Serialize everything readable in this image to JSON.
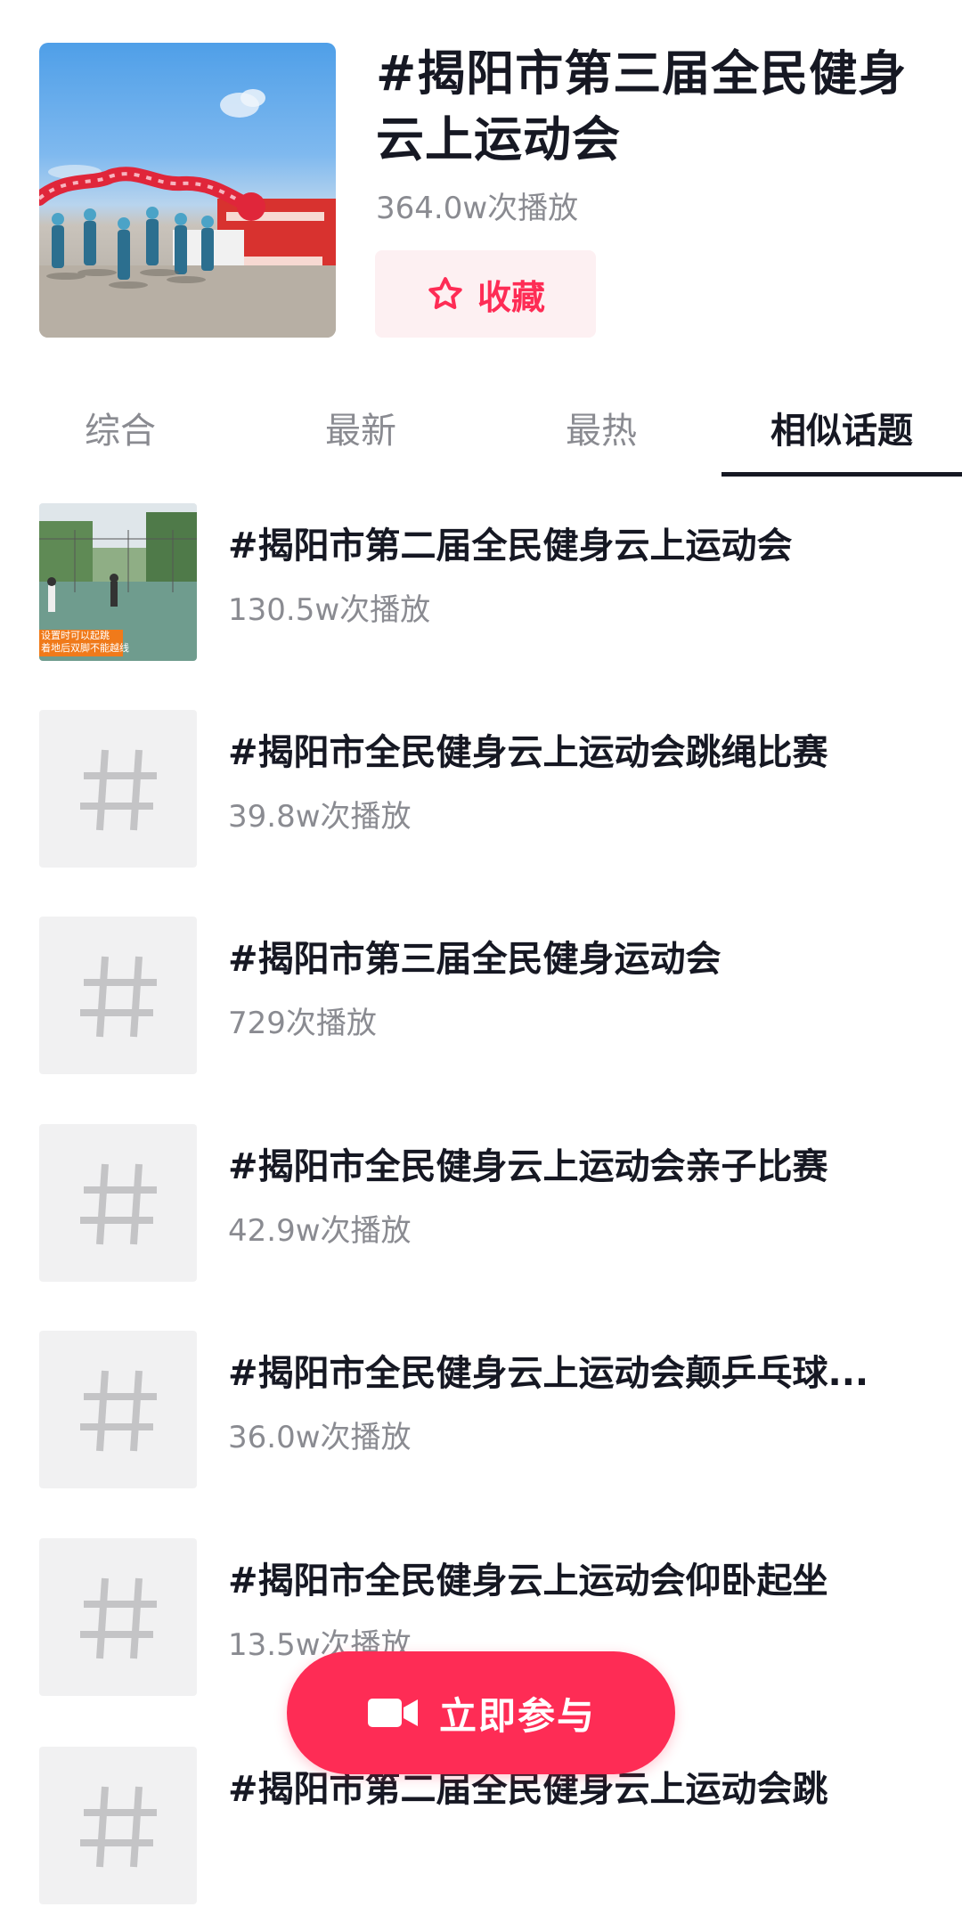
{
  "header": {
    "title": "#揭阳市第三届全民健身云上运动会",
    "plays": "364.0w次播放",
    "favorite_label": "收藏",
    "favorite_icon": "star-outline-icon",
    "accent_color": "#fe2c55"
  },
  "tabs": [
    {
      "label": "综合",
      "active": false
    },
    {
      "label": "最新",
      "active": false
    },
    {
      "label": "最热",
      "active": false
    },
    {
      "label": "相似话题",
      "active": true
    }
  ],
  "topics": [
    {
      "title": "#揭阳市第二届全民健身云上运动会",
      "plays": "130.5w次播放",
      "thumb": "photo",
      "thumb_caption_1": "设置时可以起跳",
      "thumb_caption_2": "着地后双脚不能越线"
    },
    {
      "title": "#揭阳市全民健身云上运动会跳绳比赛",
      "plays": "39.8w次播放",
      "thumb": "hashtag-icon"
    },
    {
      "title": "#揭阳市第三届全民健身运动会",
      "plays": "729次播放",
      "thumb": "hashtag-icon"
    },
    {
      "title": "#揭阳市全民健身云上运动会亲子比赛",
      "plays": "42.9w次播放",
      "thumb": "hashtag-icon"
    },
    {
      "title": "#揭阳市全民健身云上运动会颠乒乓球...",
      "plays": "36.0w次播放",
      "thumb": "hashtag-icon"
    },
    {
      "title": "#揭阳市全民健身云上运动会仰卧起坐",
      "plays": "13.5w次播放",
      "thumb": "hashtag-icon"
    },
    {
      "title": "#揭阳市第二届全民健身云上运动会跳",
      "plays": "",
      "thumb": "hashtag-icon"
    }
  ],
  "join_button": {
    "label": "立即参与",
    "icon": "video-camera-icon"
  }
}
